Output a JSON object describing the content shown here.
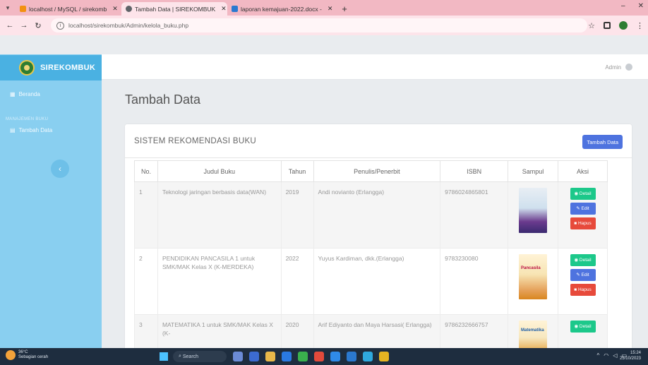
{
  "browser": {
    "tabs": [
      {
        "title": "localhost / MySQL / sirekomb",
        "icon_color": "#f29111",
        "active": false
      },
      {
        "title": "Tambah Data | SIREKOMBUK",
        "icon_color": "#5f6368",
        "active": true
      },
      {
        "title": "laporan kemajuan-2022.docx -",
        "icon_color": "#2b79d0",
        "active": false
      }
    ],
    "url": "localhost/sirekombuk/Admin/kelola_buku.php"
  },
  "brand": {
    "name": "SIREKOMBUK"
  },
  "sidebar": {
    "items": [
      {
        "label": "Beranda"
      },
      {
        "label": "Tambah Data"
      }
    ],
    "heading": "MANAJEMEN BUKU"
  },
  "topbar": {
    "user": "Admin"
  },
  "page": {
    "title": "Tambah Data"
  },
  "card": {
    "title": "SISTEM REKOMENDASI BUKU",
    "add_button": "Tambah Data"
  },
  "table": {
    "headers": [
      "No.",
      "Judul Buku",
      "Tahun",
      "Penulis/Penerbit",
      "ISBN",
      "Sampul",
      "Aksi"
    ],
    "rows": [
      {
        "no": "1",
        "judul": "Teknologi jaringan berbasis data(WAN)",
        "tahun": "2019",
        "penulis": "Andi novianto (Erlangga)",
        "isbn": "9786024865801"
      },
      {
        "no": "2",
        "judul": "PENDIDIKAN PANCASILA 1 untuk SMK/MAK Kelas X (K-MERDEKA)",
        "tahun": "2022",
        "penulis": "Yuyus Kardiman, dkk.(Erlangga)",
        "isbn": "9783230080"
      },
      {
        "no": "3",
        "judul": "MATEMATIKA 1 untuk SMK/MAK Kelas X (K-",
        "tahun": "2020",
        "penulis": "Arif Ediyanto dan Maya Harsasi( Erlangga)",
        "isbn": "9786232666757"
      }
    ],
    "cover_labels": [
      "",
      "Pancasila",
      "Matematika"
    ],
    "actions": {
      "detail": "Detail",
      "edit": "Edit",
      "hapus": "Hapus"
    }
  },
  "taskbar": {
    "weather_temp": "36°C",
    "weather_desc": "Sebagian cerah",
    "search": "Search",
    "time": "15:24",
    "date": "25/10/2023"
  }
}
